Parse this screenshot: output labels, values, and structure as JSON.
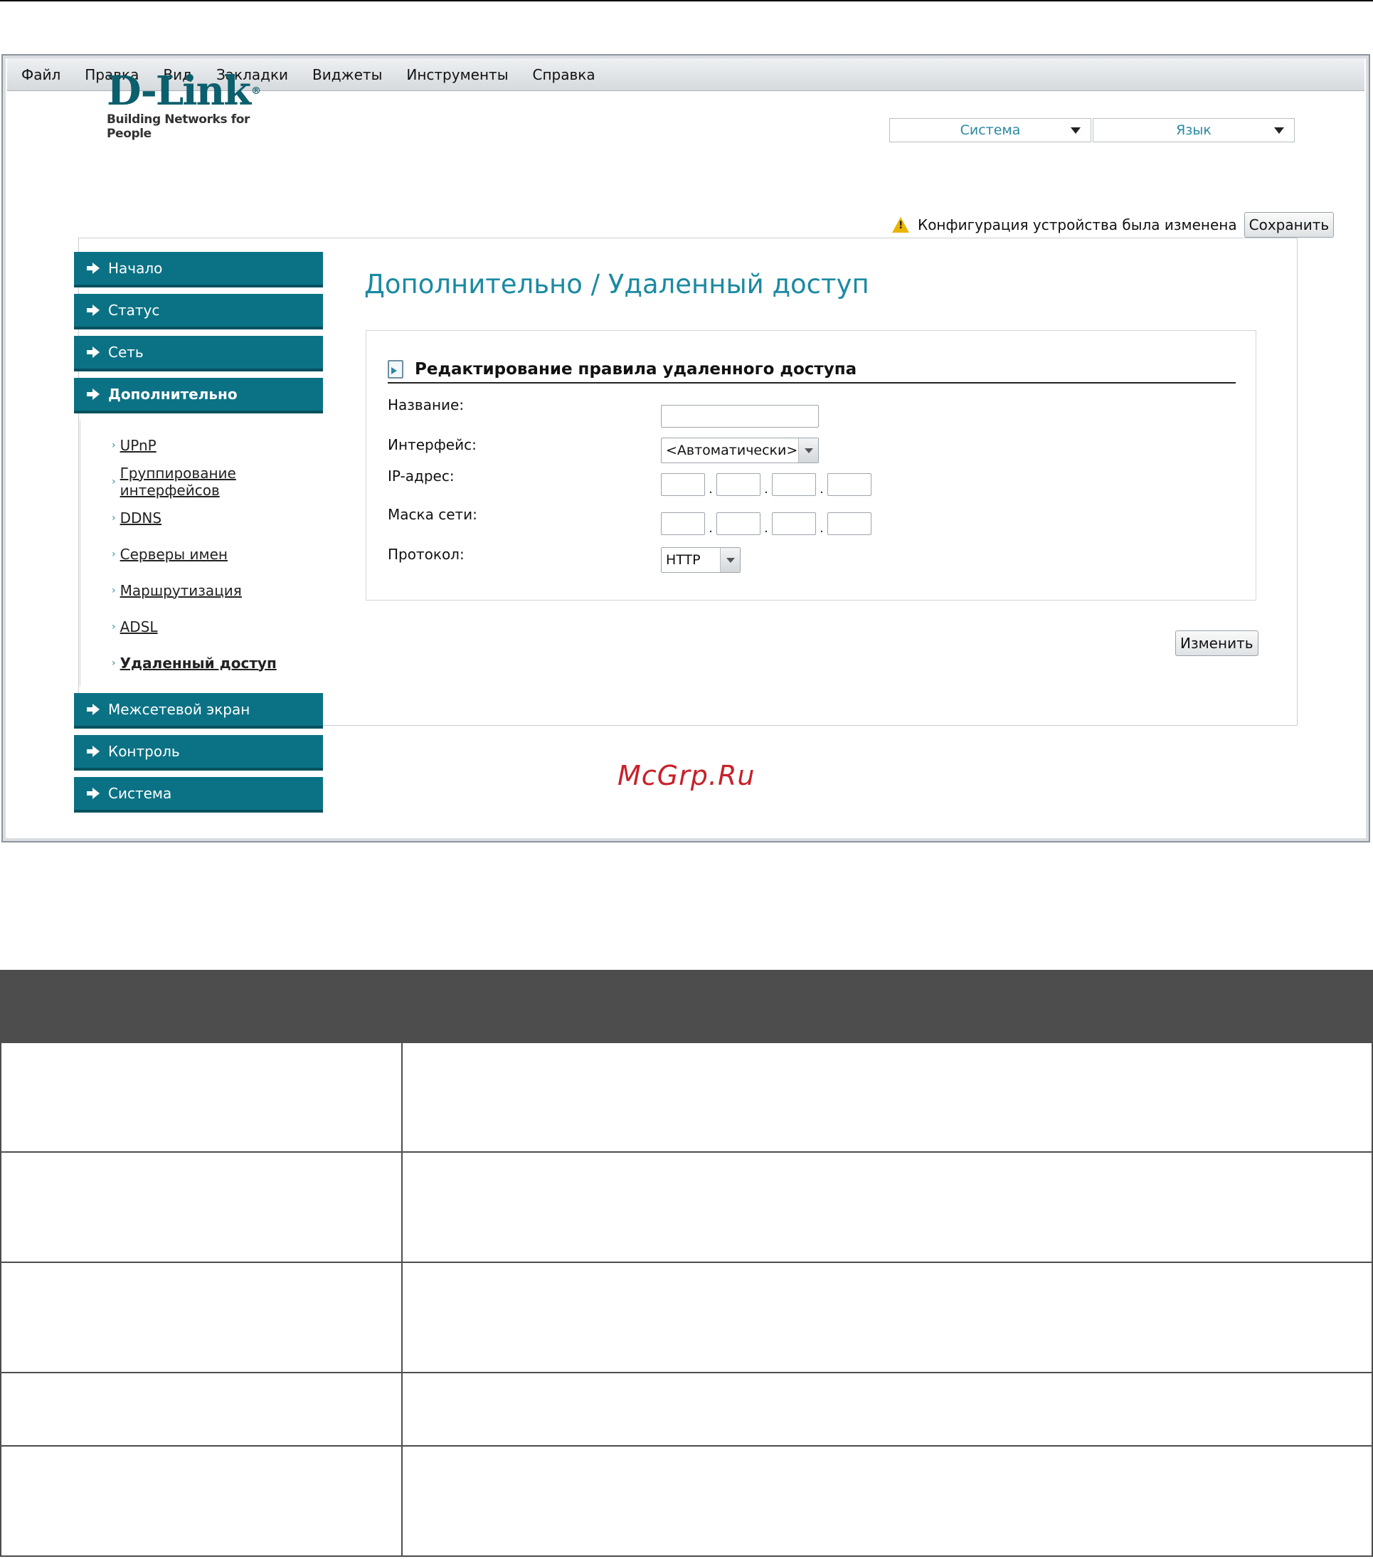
{
  "menubar": {
    "items": [
      "Файл",
      "Правка",
      "Вид",
      "Закладки",
      "Виджеты",
      "Инструменты",
      "Справка"
    ]
  },
  "logo": {
    "brand": "D-Link",
    "tagline": "Building Networks for People"
  },
  "top_selects": {
    "system": "Система",
    "language": "Язык"
  },
  "notice": {
    "text": "Конфигурация устройства была изменена",
    "save_label": "Сохранить"
  },
  "sidebar": {
    "items": [
      {
        "label": "Начало"
      },
      {
        "label": "Статус"
      },
      {
        "label": "Сеть"
      },
      {
        "label": "Дополнительно"
      },
      {
        "label": "Межсетевой экран"
      },
      {
        "label": "Контроль"
      },
      {
        "label": "Система"
      }
    ],
    "subitems": [
      {
        "label": "UPnP"
      },
      {
        "label": "Группирование интерфейсов"
      },
      {
        "label": "DDNS"
      },
      {
        "label": "Серверы имен"
      },
      {
        "label": "Маршрутизация"
      },
      {
        "label": "ADSL"
      },
      {
        "label": "Удаленный доступ"
      }
    ]
  },
  "main": {
    "page_title": "Дополнительно /  Удаленный доступ",
    "panel_title": "Редактирование правила удаленного доступа",
    "fields": {
      "name_label": "Название:",
      "name_value": "",
      "interface_label": "Интерфейс:",
      "interface_value": "<Автоматически>",
      "ip_label": "IP-адрес:",
      "mask_label": "Маска сети:",
      "protocol_label": "Протокол:",
      "protocol_value": "HTTP"
    },
    "change_label": "Изменить"
  },
  "watermark": "McGrp.Ru",
  "colors": {
    "accent": "#0b7285",
    "title": "#1b8aa2",
    "table_header": "#4d4d4d"
  }
}
